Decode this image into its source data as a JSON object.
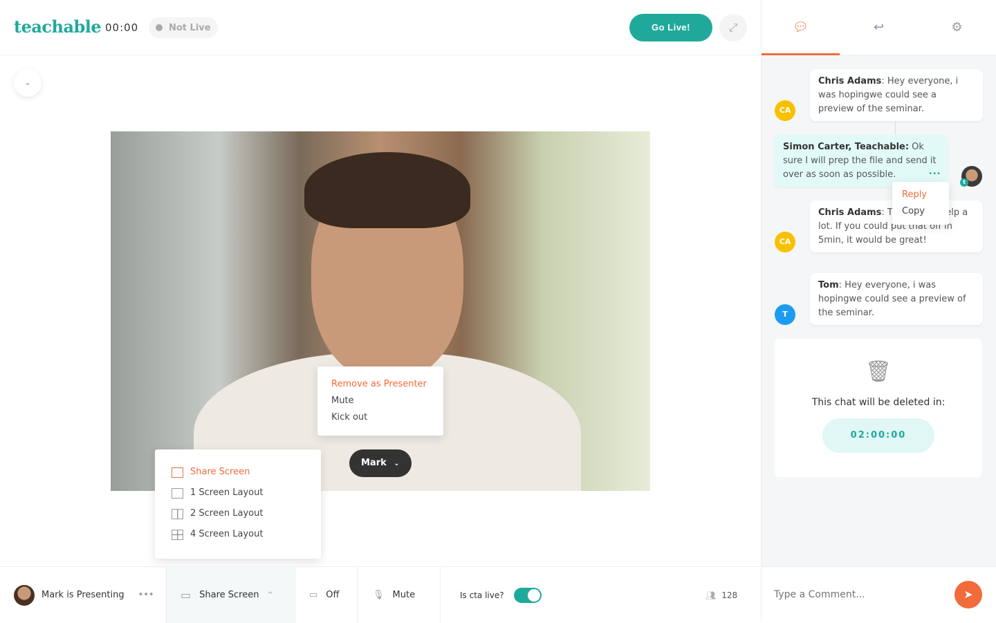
{
  "header": {
    "logo": "teachable",
    "timer": "00:00",
    "status": "Not Live",
    "go_live": "Go Live!",
    "expand_icon": "expand-icon"
  },
  "video": {
    "presenter_menu": [
      "Remove as Presenter",
      "Mute",
      "Kick out"
    ],
    "name_button": "Mark"
  },
  "share_menu": {
    "items": [
      "Share Screen",
      "1 Screen Layout",
      "2 Screen Layout",
      "4 Screen Layout"
    ]
  },
  "bottom": {
    "presenting": "Mark is Presenting",
    "share": "Share Screen",
    "camera": "Off",
    "mic": "Mute",
    "cta_label": "Is cta live?",
    "cta_on": true,
    "attendees": "128"
  },
  "chat": {
    "messages": [
      {
        "author": "Chris Adams",
        "text": ": Hey everyone, i was hopingwe could see a preview of the seminar.",
        "initials": "CA"
      },
      {
        "author": "Simon Carter, Teachable:",
        "text": " Ok sure I will prep the file and send it over as soon as possible.",
        "initials": "t"
      },
      {
        "author": "Chris Adams",
        "text": ": That would help a lot. If you could put that off in 5min, it would be great!",
        "initials": "CA"
      },
      {
        "author": "Tom",
        "text": ": Hey everyone, i was hopingwe could see a preview of the seminar.",
        "initials": "T"
      }
    ],
    "context_menu": [
      "Reply",
      "Copy"
    ],
    "delete_notice": "This chat will be deleted in:",
    "countdown": "02:00:00",
    "comment_placeholder": "Type a Comment..."
  },
  "colors": {
    "accent": "#1fa99b",
    "orange": "#f26b3a",
    "yellow": "#f8c100",
    "blue": "#1b9cf0"
  }
}
